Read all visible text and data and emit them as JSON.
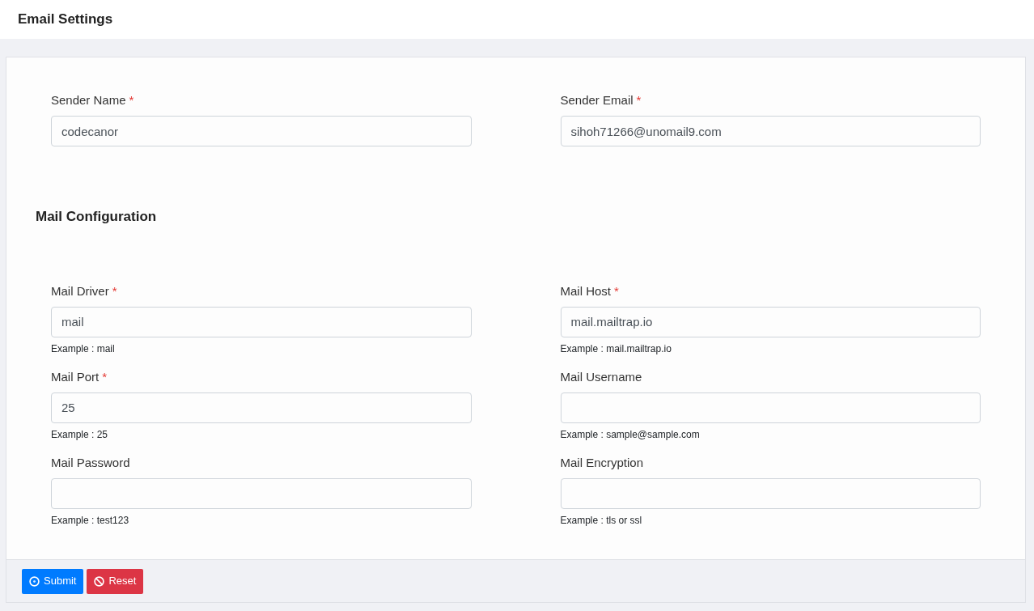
{
  "header": {
    "title": "Email Settings"
  },
  "sender_fields": [
    {
      "label": "Sender Name",
      "required_mark": "*",
      "value": "codecanor"
    },
    {
      "label": "Sender Email",
      "required_mark": "*",
      "value": "sihoh71266@unomail9.com"
    }
  ],
  "mail_configuration": {
    "title": "Mail Configuration",
    "fields": [
      {
        "label": "Mail Driver",
        "required_mark": "*",
        "value": "mail",
        "hint": "Example : mail"
      },
      {
        "label": "Mail Host",
        "required_mark": "*",
        "value": "mail.mailtrap.io",
        "hint": "Example : mail.mailtrap.io"
      },
      {
        "label": "Mail Port",
        "required_mark": "*",
        "value": "25",
        "hint": "Example : 25"
      },
      {
        "label": "Mail Username",
        "hint": "Example : sample@sample.com"
      },
      {
        "label": "Mail Password",
        "hint": "Example : test123"
      },
      {
        "label": "Mail Encryption",
        "hint": "Example : tls or ssl"
      }
    ]
  },
  "buttons": [
    {
      "kind": "submit",
      "label": "Submit"
    },
    {
      "kind": "reset",
      "label": "Reset"
    }
  ]
}
